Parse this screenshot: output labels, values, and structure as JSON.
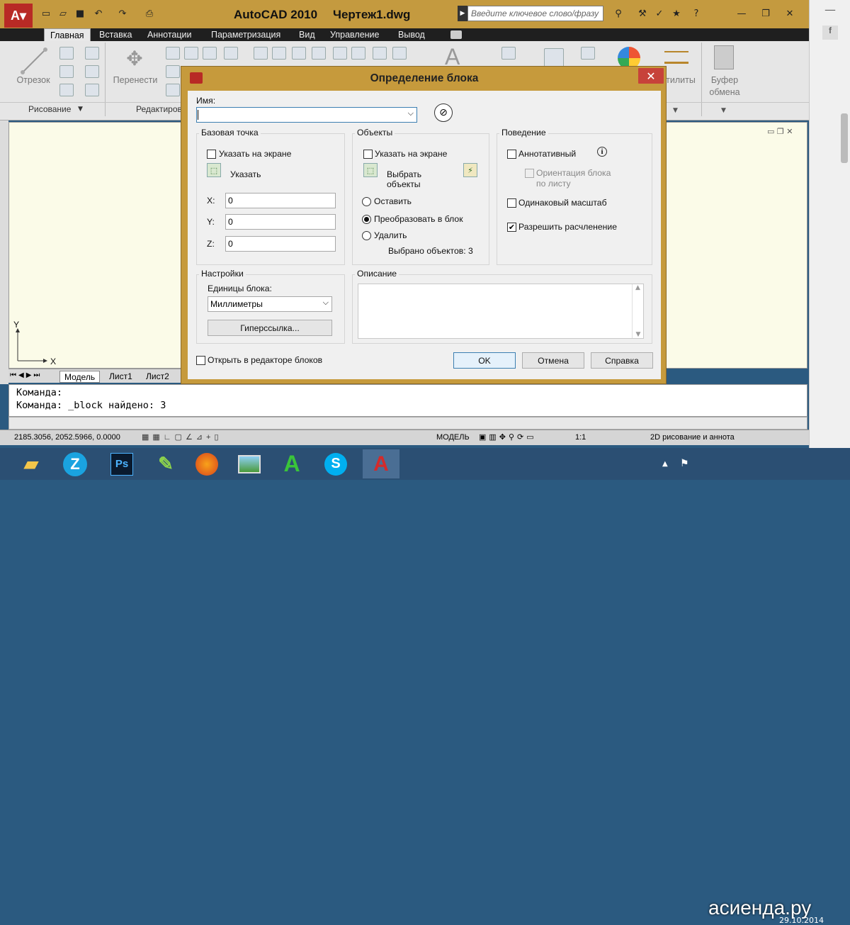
{
  "titlebar": {
    "app_name": "AutoCAD 2010",
    "file_name": "Чертеж1.dwg",
    "search_placeholder": "Введите ключевое слово/фразу"
  },
  "ribbon_tabs": [
    "Главная",
    "Вставка",
    "Аннотации",
    "Параметризация",
    "Вид",
    "Управление",
    "Вывод"
  ],
  "ribbon": {
    "line_tool": "Отрезок",
    "move_tool": "Перенести",
    "draw_panel": "Рисование",
    "modify_panel": "Редактиров",
    "utilities": "тилиты",
    "clipboard_line1": "Буфер",
    "clipboard_line2": "обмена"
  },
  "layout_tabs": [
    "Модель",
    "Лист1",
    "Лист2"
  ],
  "axis": {
    "x": "X",
    "y": "Y"
  },
  "command_line": [
    "Команда:",
    "Команда:  _block найдено: 3"
  ],
  "status": {
    "coords": "2185.3056, 2052.5966, 0.0000",
    "model": "МОДЕЛЬ",
    "scale": "1:1",
    "workspace": "2D рисование и аннота"
  },
  "dialog": {
    "title": "Определение блока",
    "name_label": "Имя:",
    "name_value": "",
    "base_point": {
      "title": "Базовая точка",
      "specify_on_screen": "Указать на экране",
      "pick_label": "Указать",
      "x_label": "X:",
      "x_value": "0",
      "y_label": "Y:",
      "y_value": "0",
      "z_label": "Z:",
      "z_value": "0"
    },
    "objects": {
      "title": "Объекты",
      "specify_on_screen": "Указать на экране",
      "select_line1": "Выбрать",
      "select_line2": "объекты",
      "retain": "Оставить",
      "convert": "Преобразовать в блок",
      "delete": "Удалить",
      "selected_count": "Выбрано объектов: 3"
    },
    "behavior": {
      "title": "Поведение",
      "annotative": "Аннотативный",
      "orient_line1": "Ориентация блока",
      "orient_line2": "по листу",
      "uniform_scale": "Одинаковый масштаб",
      "allow_explode": "Разрешить расчленение"
    },
    "settings": {
      "title": "Настройки",
      "units_label": "Единицы блока:",
      "units_value": "Миллиметры",
      "hyperlink": "Гиперссылка..."
    },
    "description": {
      "title": "Описание"
    },
    "open_in_editor": "Открыть в редакторе блоков",
    "ok": "OK",
    "cancel": "Отмена",
    "help": "Справка"
  },
  "taskbar": {
    "watermark": "асиенда.ру",
    "date": "29.10.2014"
  },
  "colors": {
    "titlebar": "#c49a3f",
    "canvas": "#fbfbe8",
    "taskbar": "#2b4f73",
    "close": "#c7423a"
  }
}
